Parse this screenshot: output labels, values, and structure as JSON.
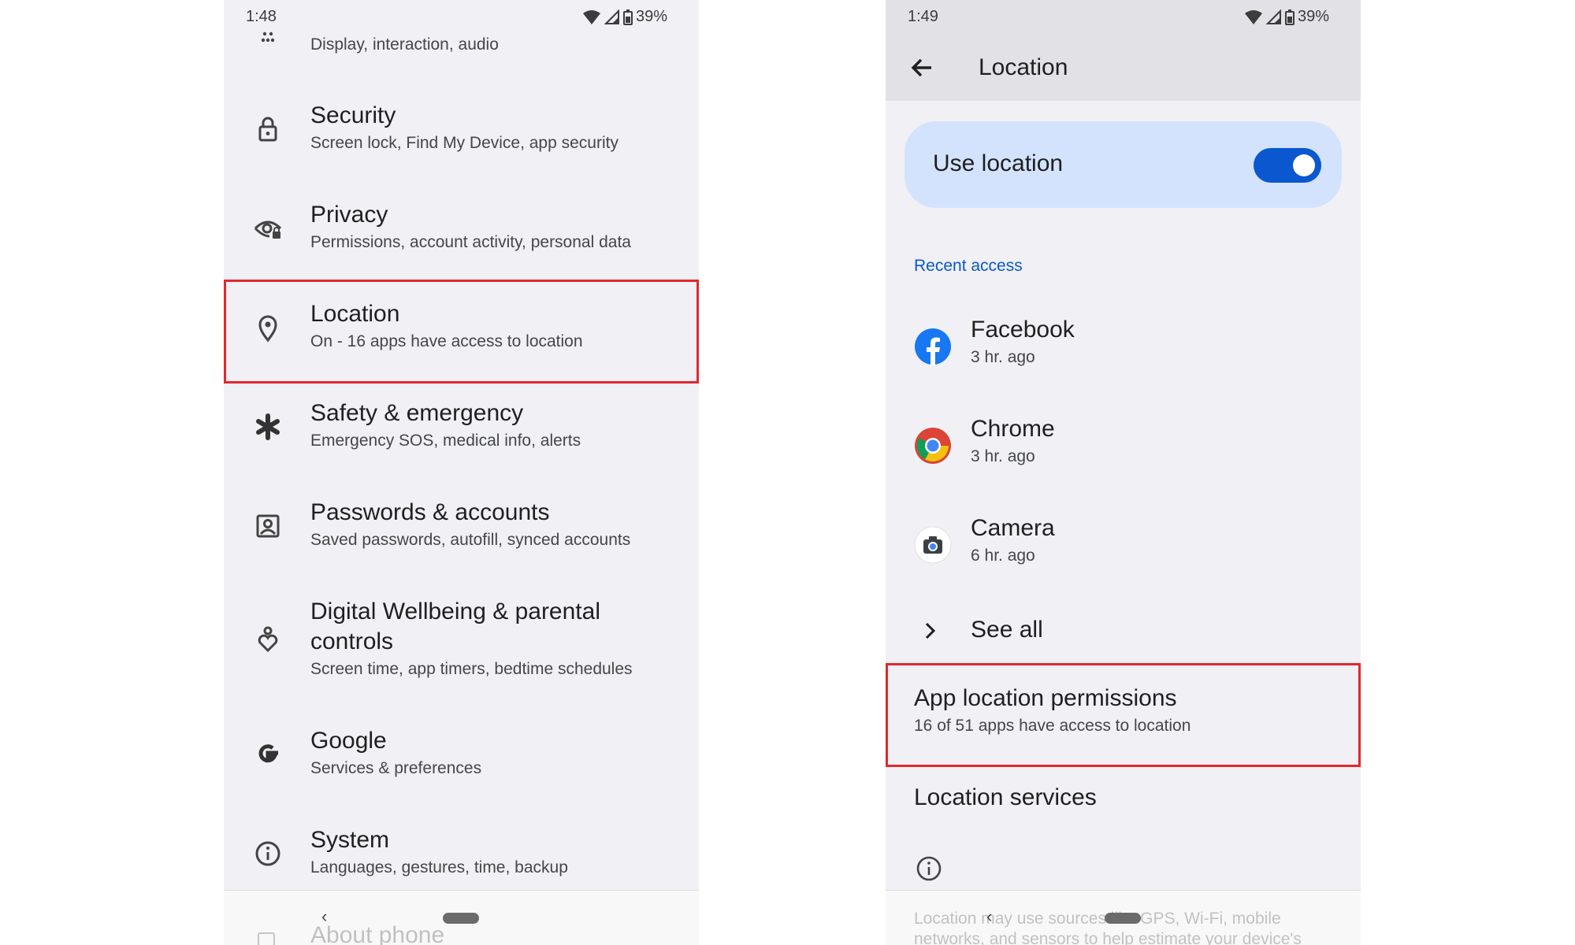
{
  "left_phone": {
    "status": {
      "time": "1:48",
      "battery": "39%"
    },
    "top_partial_subtitle": "Display, interaction, audio",
    "items": [
      {
        "title": "Security",
        "subtitle": "Screen lock, Find My Device, app security",
        "icon": "lock-icon"
      },
      {
        "title": "Privacy",
        "subtitle": "Permissions, account activity, personal data",
        "icon": "privacy-eye-icon"
      },
      {
        "title": "Location",
        "subtitle": "On - 16 apps have access to location",
        "icon": "location-pin-icon",
        "highlighted": true
      },
      {
        "title": "Safety & emergency",
        "subtitle": "Emergency SOS, medical info, alerts",
        "icon": "asterisk-icon"
      },
      {
        "title": "Passwords & accounts",
        "subtitle": "Saved passwords, autofill, synced accounts",
        "icon": "account-box-icon"
      },
      {
        "title": "Digital Wellbeing & parental controls",
        "subtitle": "Screen time, app timers, bedtime schedules",
        "icon": "wellbeing-icon"
      },
      {
        "title": "Google",
        "subtitle": "Services & preferences",
        "icon": "google-g-icon"
      },
      {
        "title": "System",
        "subtitle": "Languages, gestures, time, backup",
        "icon": "info-icon"
      }
    ],
    "partial_bottom_item": "About phone"
  },
  "right_phone": {
    "status": {
      "time": "1:49",
      "battery": "39%"
    },
    "appbar_title": "Location",
    "use_location_label": "Use location",
    "use_location_on": true,
    "recent_access_label": "Recent access",
    "recent_apps": [
      {
        "name": "Facebook",
        "time": "3 hr. ago",
        "icon": "facebook-icon"
      },
      {
        "name": "Chrome",
        "time": "3 hr. ago",
        "icon": "chrome-icon"
      },
      {
        "name": "Camera",
        "time": "6 hr. ago",
        "icon": "camera-icon"
      }
    ],
    "see_all_label": "See all",
    "app_permissions": {
      "title": "App location permissions",
      "subtitle": "16 of 51 apps have access to location"
    },
    "location_services_label": "Location services",
    "footer_line1": "Location may use sources like GPS, Wi-Fi, mobile",
    "footer_line2": "networks, and sensors to help estimate your device's"
  },
  "colors": {
    "highlight": "#e0282e",
    "accent": "#0b57d0",
    "card": "#d3e3fd",
    "background": "#f1f0f4"
  }
}
